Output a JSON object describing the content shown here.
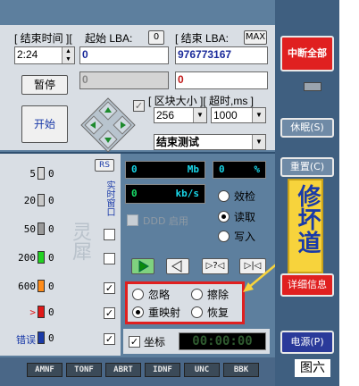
{
  "header": {
    "end_time_label": "[ 结束时间 ][",
    "start_lba_label": "起始 LBA:",
    "start_lba_index": "0",
    "end_lba_label": "[ 结束 LBA:",
    "end_lba_max": "MAX"
  },
  "fields": {
    "end_time": "2:24",
    "start_lba": "0",
    "end_lba": "976773167",
    "start_lba_disabled": "0",
    "end_lba_value2": "0"
  },
  "buttons": {
    "pause": "暂停",
    "start": "开始",
    "stop_all": "中断全部",
    "sleep": "休眠(S)",
    "reset": "重置(C)",
    "details": "详细信息",
    "power": "电源(P)"
  },
  "block_size": {
    "label": "[ 区块大小 ][ 超时,ms ]",
    "value": "256",
    "timeout": "1000"
  },
  "end_test": {
    "value": "结束测试"
  },
  "stats": {
    "rs_label": "RS",
    "rows": [
      {
        "label": "5",
        "count": "0",
        "color": "#d8d8d8"
      },
      {
        "label": "20",
        "count": "0",
        "color": "#c8c8c8"
      },
      {
        "label": "50",
        "count": "0",
        "color": "#9a9a9a"
      },
      {
        "label": "200",
        "count": "0",
        "color": "#22d222"
      },
      {
        "label": "600",
        "count": "0",
        "color": "#ff8c1a"
      },
      {
        "label": ">",
        "count": "0",
        "color": "#e01818"
      },
      {
        "label": "错误",
        "count": "0",
        "color": "#1a3aa8"
      }
    ],
    "realtime_label": "实时窗口",
    "watermark": "灵犀"
  },
  "display": {
    "mb_value": "0",
    "mb_unit": "Mb",
    "pct_value": "0",
    "pct_unit": "%",
    "kbs_value": "0",
    "kbs_unit": "kb/s",
    "ddd_label": "DDD 启用"
  },
  "mode": {
    "verify": "效检",
    "read": "读取",
    "write": "写入"
  },
  "error_mode": {
    "ignore": "忽略",
    "erase": "擦除",
    "remap": "重映射",
    "restore": "恢复"
  },
  "playback": {
    "b3": "▷?◁",
    "b4": "▷|◁"
  },
  "coords": {
    "label": "坐标",
    "timer": "00:00:00"
  },
  "bottom_tabs": [
    "AMNF",
    "TONF",
    "ABRT",
    "IDNF",
    "UNC",
    "BBK"
  ],
  "annotations": {
    "repair_label": "修坏道",
    "figure_label": "图六"
  },
  "colors": {
    "panel": "#5d7f9e",
    "sidebar": "#3f5f80",
    "highlight": "#e02020",
    "annotation_bg": "#f7d33c"
  }
}
